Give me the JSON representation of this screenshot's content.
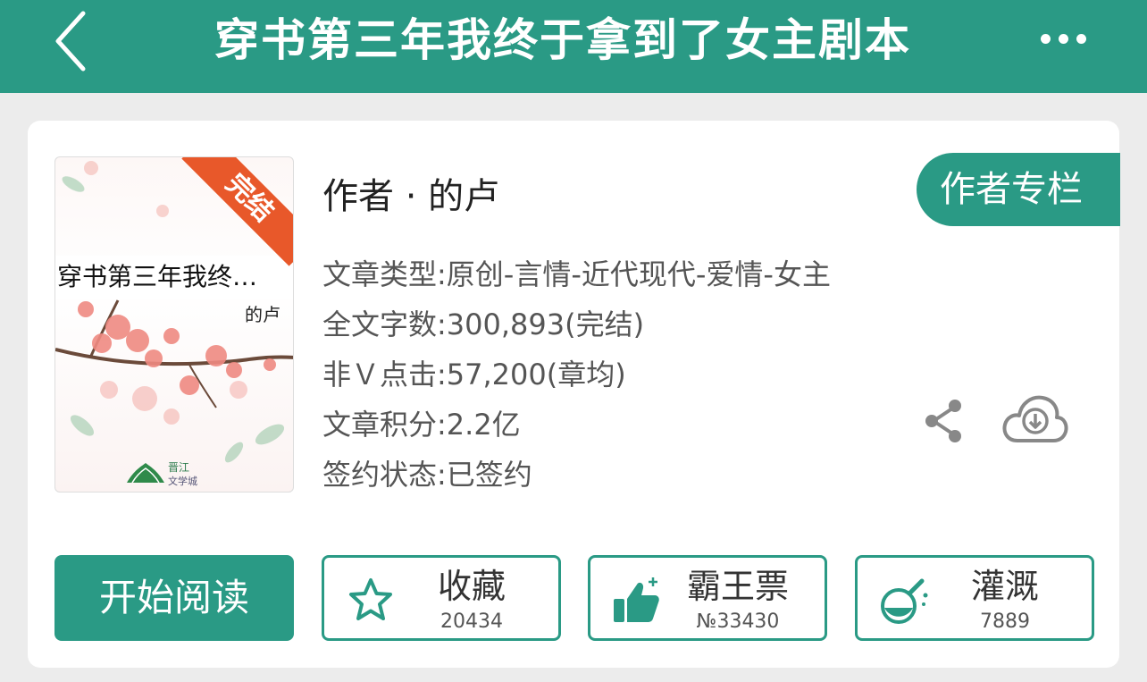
{
  "header": {
    "title": "穿书第三年我终于拿到了女主剧本",
    "back_icon": "chevron-left-icon",
    "more_icon": "more-horizontal-icon"
  },
  "book": {
    "cover": {
      "title": "穿书第三年我终…",
      "author": "的卢",
      "badge": "完结",
      "logo_text": "晋江",
      "logo_sub": "文学城"
    },
    "author_line": "作者 · 的卢",
    "author_column_button": "作者专栏",
    "info": [
      "文章类型:原创-言情-近代现代-爱情-女主",
      "全文字数:300,893(完结)",
      "非Ｖ点击:57,200(章均)",
      "文章积分:2.2亿",
      "签约状态:已签约"
    ],
    "share_icon": "share-icon",
    "download_icon": "cloud-download-icon"
  },
  "actions": {
    "start_reading": "开始阅读",
    "favorite": {
      "label": "收藏",
      "count": "20434",
      "icon": "star-icon"
    },
    "bawangpiao": {
      "label": "霸王票",
      "count": "№33430",
      "icon": "thumbs-up-icon"
    },
    "irrigate": {
      "label": "灌溉",
      "count": "7889",
      "icon": "flask-icon"
    }
  },
  "colors": {
    "brand": "#2a9a85",
    "badge": "#e8582a"
  }
}
